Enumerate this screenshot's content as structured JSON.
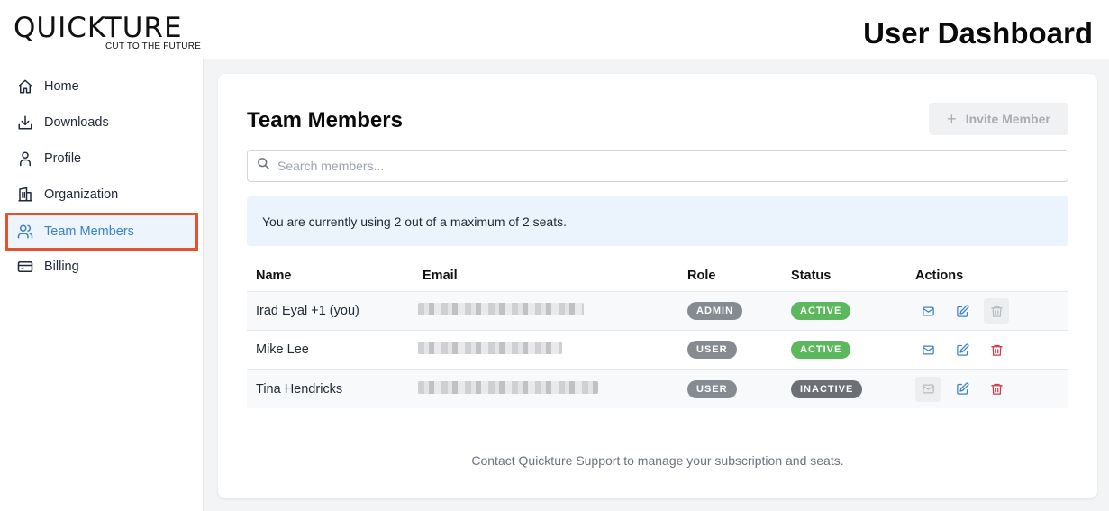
{
  "app": {
    "logo": "QUICKTURE",
    "tagline": "CUT TO THE FUTURE",
    "page_title": "User Dashboard"
  },
  "sidebar": {
    "items": [
      {
        "label": "Home",
        "icon": "home-icon"
      },
      {
        "label": "Downloads",
        "icon": "download-icon"
      },
      {
        "label": "Profile",
        "icon": "user-icon"
      },
      {
        "label": "Organization",
        "icon": "building-icon"
      },
      {
        "label": "Team Members",
        "icon": "users-icon",
        "active": true
      },
      {
        "label": "Billing",
        "icon": "credit-card-icon"
      }
    ]
  },
  "main": {
    "title": "Team Members",
    "invite_label": "Invite Member",
    "search_placeholder": "Search members...",
    "notice": "You are currently using 2 out of a maximum of 2 seats.",
    "columns": [
      "Name",
      "Email",
      "Role",
      "Status",
      "Actions"
    ],
    "members": [
      {
        "name": "Irad Eyal +1 (you)",
        "role": "ADMIN",
        "status": "ACTIVE",
        "email_disabled": false,
        "delete_disabled": true
      },
      {
        "name": "Mike Lee",
        "role": "USER",
        "status": "ACTIVE",
        "email_disabled": false,
        "delete_disabled": false
      },
      {
        "name": "Tina Hendricks",
        "role": "USER",
        "status": "INACTIVE",
        "email_disabled": true,
        "delete_disabled": false
      }
    ],
    "footer": "Contact Quickture Support to manage your subscription and seats."
  },
  "colors": {
    "accent": "#3b82c6",
    "highlight_border": "#e4532f",
    "active_badge": "#5cb85c",
    "inactive_badge": "#6c7075",
    "delete_icon": "#dc3545"
  }
}
